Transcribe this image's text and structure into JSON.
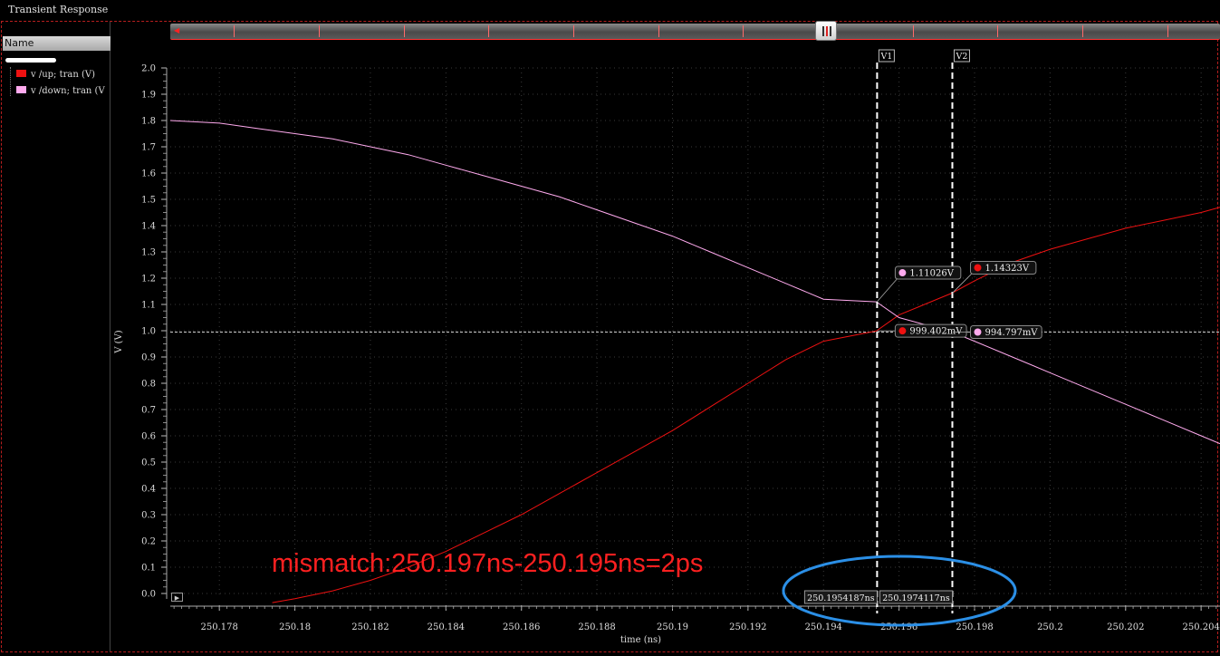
{
  "window": {
    "title": "Transient Response"
  },
  "sidebar": {
    "header": "Name",
    "items": [
      {
        "label": "v /up; tran (V)",
        "color": "#ee1111"
      },
      {
        "label": "v /down; tran (V",
        "color": "#ffaaee"
      }
    ]
  },
  "annotation": {
    "text": "mismatch:250.197ns-250.195ns=2ps",
    "color": "#ff2020",
    "ellipse_color": "#2b8fe6"
  },
  "chart_data": {
    "type": "line",
    "xlabel": "time (ns)",
    "ylabel": "V (V)",
    "xlim": [
      250.1767,
      250.2045
    ],
    "ylim": [
      0.0,
      2.0
    ],
    "x_ticks": [
      "250.178",
      "250.18",
      "250.182",
      "250.184",
      "250.186",
      "250.188",
      "250.19",
      "250.192",
      "250.194",
      "250.196",
      "250.198",
      "250.2",
      "250.202",
      "250.204"
    ],
    "y_ticks": [
      "0.0",
      "0.1",
      "0.2",
      "0.3",
      "0.4",
      "0.5",
      "0.6",
      "0.7",
      "0.8",
      "0.9",
      "1.0",
      "1.1",
      "1.2",
      "1.3",
      "1.4",
      "1.5",
      "1.6",
      "1.7",
      "1.8",
      "1.9",
      "2.0"
    ],
    "grid": true,
    "background": "#000000",
    "series": [
      {
        "name": "v /up; tran (V)",
        "color": "#ee1111",
        "x": [
          250.1794,
          250.18,
          250.181,
          250.182,
          250.183,
          250.184,
          250.185,
          250.186,
          250.187,
          250.188,
          250.189,
          250.19,
          250.191,
          250.192,
          250.193,
          250.194,
          250.1954,
          250.196,
          250.1974,
          250.198,
          250.199,
          250.2,
          250.201,
          250.202,
          250.203,
          250.204,
          250.2045
        ],
        "y": [
          -0.035,
          -0.02,
          0.01,
          0.05,
          0.1,
          0.16,
          0.23,
          0.3,
          0.38,
          0.46,
          0.54,
          0.62,
          0.71,
          0.8,
          0.89,
          0.96,
          0.999,
          1.06,
          1.143,
          1.19,
          1.26,
          1.31,
          1.35,
          1.39,
          1.42,
          1.45,
          1.47
        ]
      },
      {
        "name": "v /down; tran (V",
        "color": "#ffaaee",
        "x": [
          250.1767,
          250.178,
          250.179,
          250.18,
          250.181,
          250.182,
          250.183,
          250.184,
          250.185,
          250.186,
          250.187,
          250.188,
          250.189,
          250.19,
          250.191,
          250.192,
          250.193,
          250.194,
          250.1954,
          250.196,
          250.1974,
          250.198,
          250.199,
          250.2,
          250.201,
          250.202,
          250.203,
          250.204,
          250.2045
        ],
        "y": [
          1.8,
          1.79,
          1.77,
          1.75,
          1.73,
          1.7,
          1.67,
          1.63,
          1.59,
          1.55,
          1.51,
          1.46,
          1.41,
          1.36,
          1.3,
          1.24,
          1.18,
          1.12,
          1.11,
          1.05,
          0.995,
          0.96,
          0.9,
          0.84,
          0.78,
          0.72,
          0.66,
          0.6,
          0.57
        ]
      }
    ],
    "hline": {
      "y": 0.995
    },
    "cursors": [
      {
        "label": "V1",
        "x": 250.1954187,
        "time_label": "250.1954187ns"
      },
      {
        "label": "V2",
        "x": 250.1974117,
        "time_label": "250.1974117ns"
      }
    ],
    "markers": [
      {
        "x": 250.1954187,
        "y": 1.11026,
        "label": "1.11026V",
        "color": "#ffaaee"
      },
      {
        "x": 250.1974117,
        "y": 1.14323,
        "label": "1.14323V",
        "color": "#ee1111"
      },
      {
        "x": 250.1954187,
        "y": 0.999402,
        "label": "999.402mV",
        "color": "#ee1111"
      },
      {
        "x": 250.1974117,
        "y": 0.994797,
        "label": "994.797mV",
        "color": "#ffaaee"
      }
    ]
  }
}
